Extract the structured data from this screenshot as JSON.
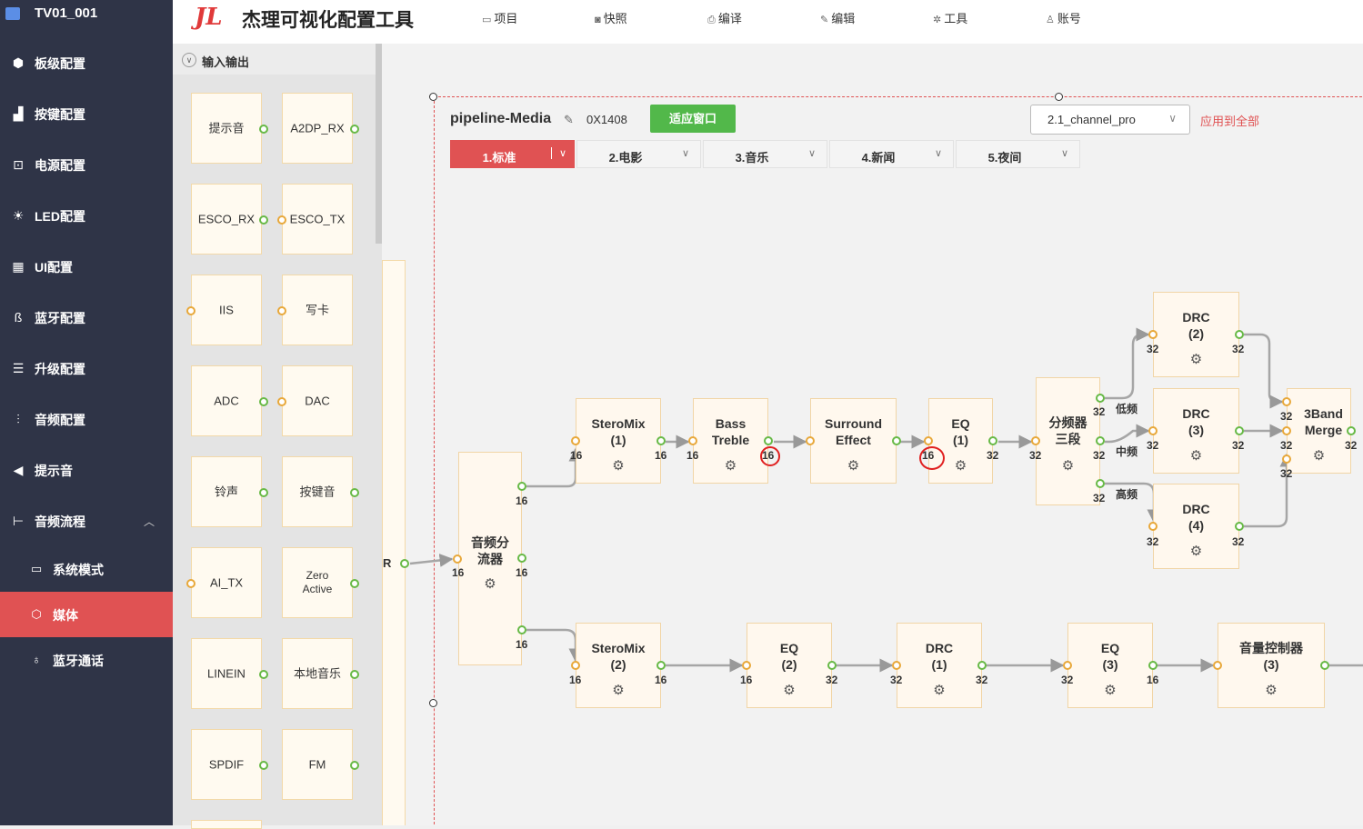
{
  "sidebar": {
    "project": "TV01_001",
    "items": [
      {
        "label": "板级配置",
        "icon": "cube-icon"
      },
      {
        "label": "按键配置",
        "icon": "keys-icon"
      },
      {
        "label": "电源配置",
        "icon": "power-icon"
      },
      {
        "label": "LED配置",
        "icon": "bulb-icon"
      },
      {
        "label": "UI配置",
        "icon": "grid-icon"
      },
      {
        "label": "蓝牙配置",
        "icon": "bluetooth-icon"
      },
      {
        "label": "升级配置",
        "icon": "list-icon"
      },
      {
        "label": "音频配置",
        "icon": "equalizer-icon"
      },
      {
        "label": "提示音",
        "icon": "speaker-icon"
      },
      {
        "label": "音频流程",
        "icon": "flow-icon"
      }
    ],
    "subitems": [
      {
        "label": "系统模式",
        "icon": "monitor-icon"
      },
      {
        "label": "媒体",
        "icon": "box-icon"
      },
      {
        "label": "蓝牙通话",
        "icon": "microphone-icon"
      }
    ]
  },
  "header": {
    "logo": "JL",
    "title": "杰理可视化配置工具",
    "menus": [
      "项目",
      "快照",
      "编译",
      "编辑",
      "工具",
      "账号"
    ]
  },
  "palette": {
    "title": "输入输出",
    "items": [
      "提示音",
      "A2DP_RX",
      "ESCO_RX",
      "ESCO_TX",
      "IIS",
      "写卡",
      "ADC",
      "DAC",
      "铃声",
      "按键音",
      "AI_TX",
      "Zero Active",
      "LINEIN",
      "本地音乐",
      "SPDIF",
      "FM"
    ]
  },
  "pipeline": {
    "name": "pipeline-Media",
    "id": "0X1408",
    "fit_button": "适应窗口",
    "channel": "2.1_channel_pro",
    "apply_all": "应用到全部",
    "tabs": [
      "1.标准",
      "2.电影",
      "3.音乐",
      "4.新闻",
      "5.夜间"
    ],
    "partial_node_label": "R",
    "nodes": [
      {
        "title": "音频分流器"
      },
      {
        "title": "SteroMix (1)"
      },
      {
        "title": "Bass Treble"
      },
      {
        "title": "Surround Effect"
      },
      {
        "title": "EQ (1)"
      },
      {
        "title": "分频器三段"
      },
      {
        "title": "DRC (2)"
      },
      {
        "title": "DRC (3)"
      },
      {
        "title": "DRC (4)"
      },
      {
        "title": "3Band Merge"
      },
      {
        "title": "SteroMix (2)"
      },
      {
        "title": "EQ (2)"
      },
      {
        "title": "DRC (1)"
      },
      {
        "title": "EQ (3)"
      },
      {
        "title": "音量控制器 (3)"
      }
    ],
    "bands": [
      "低频",
      "中频",
      "高频"
    ],
    "bits": {
      "b16": "16",
      "b32": "32"
    }
  },
  "colors": {
    "accent": "#e05253",
    "sidebar": "#2f3447",
    "fit": "#52b84a",
    "in_port": "#e8a83a",
    "out_port": "#67b946"
  }
}
